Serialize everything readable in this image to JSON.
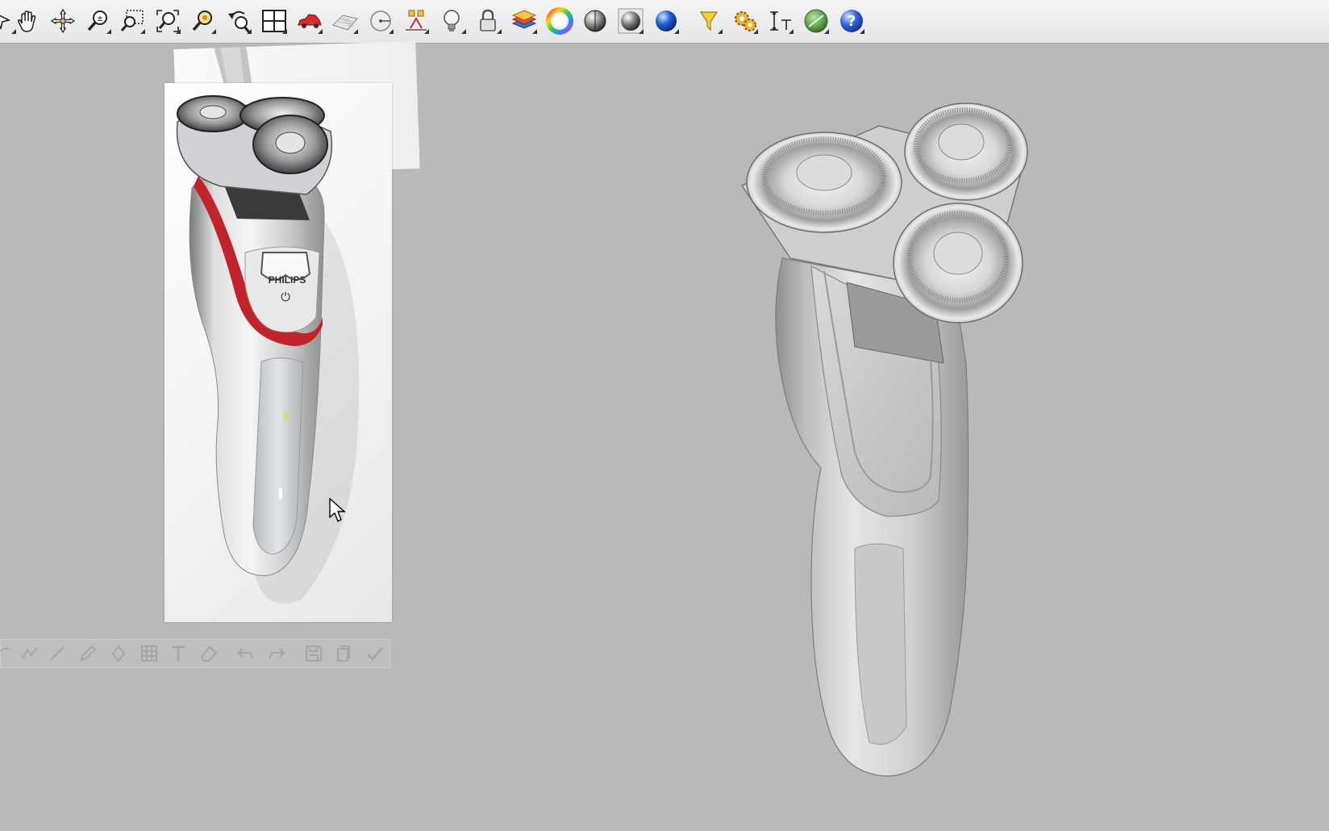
{
  "toolbar": {
    "tools": [
      {
        "name": "select-icon"
      },
      {
        "name": "pan-hand-icon"
      },
      {
        "name": "rotate-view-icon"
      },
      {
        "name": "zoom-icon"
      },
      {
        "name": "zoom-window-icon"
      },
      {
        "name": "zoom-extents-icon"
      },
      {
        "name": "zoom-selected-icon"
      },
      {
        "name": "undo-view-icon"
      },
      {
        "name": "four-viewports-icon"
      },
      {
        "name": "car-render-icon"
      },
      {
        "name": "construction-plane-icon"
      },
      {
        "name": "measure-icon"
      },
      {
        "name": "transform-icon"
      },
      {
        "name": "light-bulb-icon"
      },
      {
        "name": "lock-icon"
      },
      {
        "name": "layer-icon"
      },
      {
        "name": "color-wheel-icon"
      },
      {
        "name": "shaded-sphere-icon"
      },
      {
        "name": "rendered-sphere-icon"
      },
      {
        "name": "blue-sphere-icon"
      },
      {
        "name": "render-preview-icon"
      },
      {
        "name": "settings-gears-icon"
      },
      {
        "name": "dimension-icon"
      },
      {
        "name": "globe-icon"
      },
      {
        "name": "help-icon"
      }
    ]
  },
  "reference_image": {
    "brand_text": "PHILIPS",
    "power_symbol": "⏻"
  },
  "ghost_toolbar": {
    "tools": [
      "curve-icon",
      "polyline-icon",
      "line-icon",
      "pencil-icon",
      "pen-icon",
      "grid-icon",
      "text-icon",
      "eraser-icon",
      "undo-icon",
      "redo-icon",
      "save-icon",
      "copy-icon",
      "check-icon"
    ]
  },
  "colors": {
    "viewport_bg": "#b9b9b9",
    "shaver_accent_red": "#c0242a",
    "toolbar_bg": "#ececec"
  }
}
